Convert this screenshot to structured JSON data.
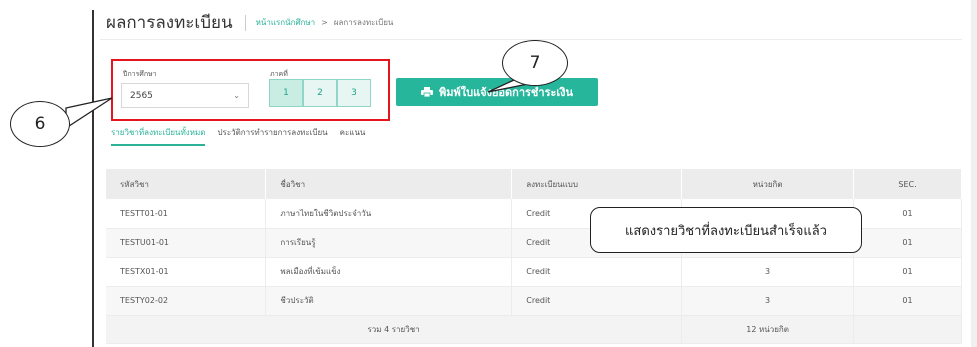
{
  "header": {
    "title": "ผลการลงทะเบียน",
    "breadcrumb": [
      "หน้าแรกนักศึกษา",
      "ผลการลงทะเบียน"
    ],
    "breadcrumb_sep": ">"
  },
  "filters": {
    "year_label": "ปีการศึกษา",
    "year_value": "2565",
    "term_label": "ภาคที่",
    "terms": [
      "1",
      "2",
      "3"
    ],
    "active_term": "1"
  },
  "print_button": {
    "label": "พิมพ์ใบแจ้งยอดการชำระเงิน",
    "icon": "printer-icon"
  },
  "callouts": {
    "six": "6",
    "seven": "7"
  },
  "tabs": [
    "รายวิชาที่ลงทะเบียนทั้งหมด",
    "ประวัติการทำรายการลงทะเบียน",
    "คะแนน"
  ],
  "table": {
    "columns": [
      "รหัสวิชา",
      "ชื่อวิชา",
      "ลงทะเบียนแบบ",
      "หน่วยกิต",
      "SEC."
    ],
    "rows": [
      [
        "TESTT01-01",
        "ภาษาไทยในชีวิตประจำวัน",
        "Credit",
        "",
        "01"
      ],
      [
        "TESTU01-01",
        "การเรียนรู้",
        "Credit",
        "",
        "01"
      ],
      [
        "TESTX01-01",
        "พลเมืองที่เข้มแข็ง",
        "Credit",
        "3",
        "01"
      ],
      [
        "TESTY02-02",
        "ชีวประวัติ",
        "Credit",
        "3",
        "01"
      ]
    ],
    "total_subjects": "รวม 4 รายวิชา",
    "total_credits": "12 หน่วยกิต"
  },
  "note": "แสดงรายวิชาที่ลงทะเบียนสำเร็จแล้ว",
  "colors": {
    "accent": "#26b69c",
    "highlight_box": "#e4151c"
  }
}
